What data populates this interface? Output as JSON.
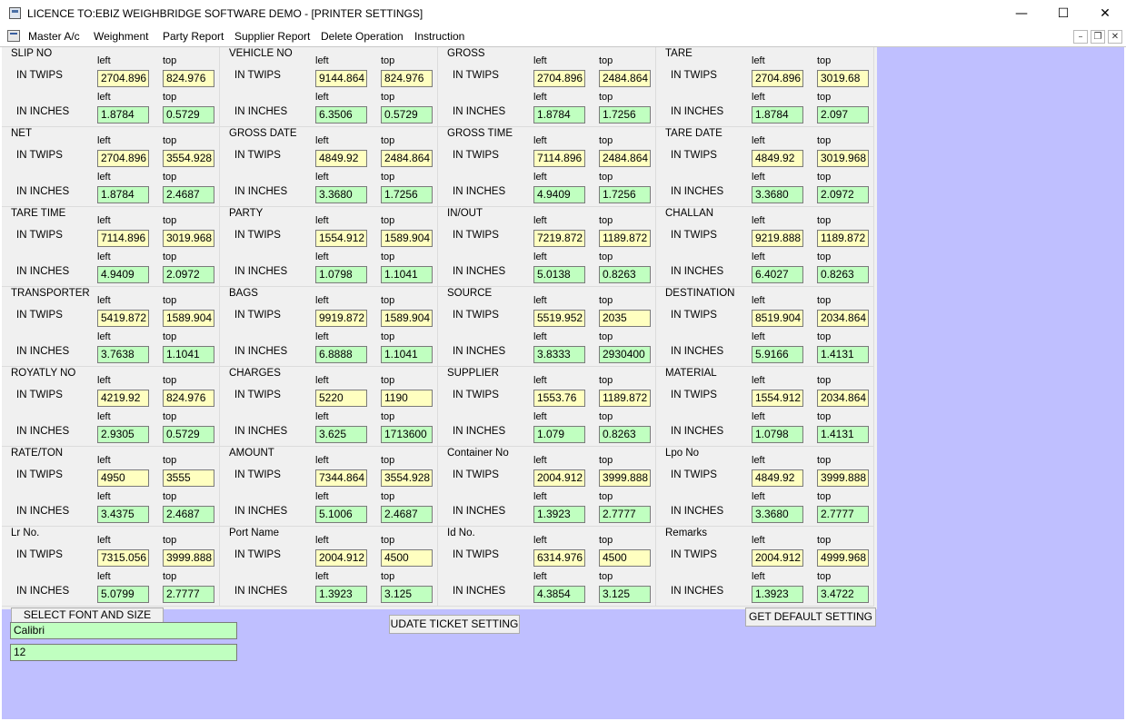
{
  "window": {
    "title": "LICENCE TO:EBIZ WEIGHBRIDGE SOFTWARE DEMO - [PRINTER SETTINGS]",
    "minimize": "—",
    "maximize": "☐",
    "close": "✕"
  },
  "menu": {
    "items": [
      "Master A/c",
      "Weighment",
      "Party Report",
      "Supplier Report",
      "Delete Operation",
      "Instruction"
    ],
    "mdi_minimize": "–",
    "mdi_restore": "❐",
    "mdi_close": "✕"
  },
  "labels": {
    "in_twips": "IN TWIPS",
    "in_inches": "IN INCHES",
    "left": "left",
    "top": "top"
  },
  "fields": [
    {
      "name": "SLIP NO",
      "twips_left": "2704.896",
      "twips_top": "824.976",
      "inch_left": "1.8784",
      "inch_top": "0.5729"
    },
    {
      "name": "VEHICLE NO",
      "twips_left": "9144.864",
      "twips_top": "824.976",
      "inch_left": "6.3506",
      "inch_top": "0.5729"
    },
    {
      "name": "GROSS",
      "twips_left": "2704.896",
      "twips_top": "2484.864",
      "inch_left": "1.8784",
      "inch_top": "1.7256"
    },
    {
      "name": "TARE",
      "twips_left": "2704.896",
      "twips_top": "3019.68",
      "inch_left": "1.8784",
      "inch_top": "2.097"
    },
    {
      "name": "NET",
      "twips_left": "2704.896",
      "twips_top": "3554.928",
      "inch_left": "1.8784",
      "inch_top": "2.4687"
    },
    {
      "name": "GROSS DATE",
      "twips_left": "4849.92",
      "twips_top": "2484.864",
      "inch_left": "3.3680",
      "inch_top": "1.7256"
    },
    {
      "name": "GROSS TIME",
      "twips_left": "7114.896",
      "twips_top": "2484.864",
      "inch_left": "4.9409",
      "inch_top": "1.7256"
    },
    {
      "name": "TARE DATE",
      "twips_left": "4849.92",
      "twips_top": "3019.968",
      "inch_left": "3.3680",
      "inch_top": "2.0972"
    },
    {
      "name": "TARE TIME",
      "twips_left": "7114.896",
      "twips_top": "3019.968",
      "inch_left": "4.9409",
      "inch_top": "2.0972"
    },
    {
      "name": "PARTY",
      "twips_left": "1554.912",
      "twips_top": "1589.904",
      "inch_left": "1.0798",
      "inch_top": "1.1041"
    },
    {
      "name": "IN/OUT",
      "twips_left": "7219.872",
      "twips_top": "1189.872",
      "inch_left": "5.0138",
      "inch_top": "0.8263"
    },
    {
      "name": "CHALLAN",
      "twips_left": "9219.888",
      "twips_top": "1189.872",
      "inch_left": "6.4027",
      "inch_top": "0.8263"
    },
    {
      "name": "TRANSPORTER",
      "twips_left": "5419.872",
      "twips_top": "1589.904",
      "inch_left": "3.7638",
      "inch_top": "1.1041"
    },
    {
      "name": "BAGS",
      "twips_left": "9919.872",
      "twips_top": "1589.904",
      "inch_left": "6.8888",
      "inch_top": "1.1041"
    },
    {
      "name": "SOURCE",
      "twips_left": "5519.952",
      "twips_top": "2035",
      "inch_left": "3.8333",
      "inch_top": "2930400"
    },
    {
      "name": "DESTINATION",
      "twips_left": "8519.904",
      "twips_top": "2034.864",
      "inch_left": "5.9166",
      "inch_top": "1.4131"
    },
    {
      "name": "ROYATLY NO",
      "twips_left": "4219.92",
      "twips_top": "824.976",
      "inch_left": "2.9305",
      "inch_top": "0.5729"
    },
    {
      "name": "CHARGES",
      "twips_left": "5220",
      "twips_top": "1190",
      "inch_left": "3.625",
      "inch_top": "1713600"
    },
    {
      "name": "SUPPLIER",
      "twips_left": "1553.76",
      "twips_top": "1189.872",
      "inch_left": "1.079",
      "inch_top": "0.8263"
    },
    {
      "name": "MATERIAL",
      "twips_left": "1554.912",
      "twips_top": "2034.864",
      "inch_left": "1.0798",
      "inch_top": "1.4131"
    },
    {
      "name": "RATE/TON",
      "twips_left": "4950",
      "twips_top": "3555",
      "inch_left": "3.4375",
      "inch_top": "2.4687"
    },
    {
      "name": "AMOUNT",
      "twips_left": "7344.864",
      "twips_top": "3554.928",
      "inch_left": "5.1006",
      "inch_top": "2.4687"
    },
    {
      "name": "Container No",
      "twips_left": "2004.912",
      "twips_top": "3999.888",
      "inch_left": "1.3923",
      "inch_top": "2.7777"
    },
    {
      "name": "Lpo No",
      "twips_left": "4849.92",
      "twips_top": "3999.888",
      "inch_left": "3.3680",
      "inch_top": "2.7777"
    },
    {
      "name": "Lr No.",
      "twips_left": "7315.056",
      "twips_top": "3999.888",
      "inch_left": "5.0799",
      "inch_top": "2.7777"
    },
    {
      "name": "Port Name",
      "twips_left": "2004.912",
      "twips_top": "4500",
      "inch_left": "1.3923",
      "inch_top": "3.125"
    },
    {
      "name": "Id No.",
      "twips_left": "6314.976",
      "twips_top": "4500",
      "inch_left": "4.3854",
      "inch_top": "3.125"
    },
    {
      "name": "Remarks",
      "twips_left": "2004.912",
      "twips_top": "4999.968",
      "inch_left": "1.3923",
      "inch_top": "3.4722"
    }
  ],
  "font": {
    "button_label": "SELECT FONT AND SIZE",
    "name": "Calibri",
    "size": "12"
  },
  "actions": {
    "update_label": "UDATE TICKET SETTING",
    "default_label": "GET DEFAULT SETTING"
  },
  "colors": {
    "client_background": "#bfbfff",
    "twips_box": "#ffffc0",
    "inches_box": "#c0ffc0"
  }
}
